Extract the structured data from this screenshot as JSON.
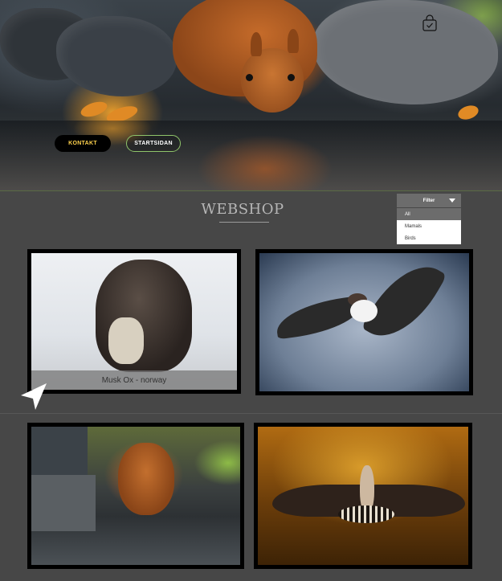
{
  "header": {
    "buttons": {
      "kontakt": "KONTAKT",
      "startsidan": "STARTSIDAN"
    },
    "icons": {
      "bag": "shopping-bag-check-icon"
    }
  },
  "webshop": {
    "title": "WEBSHOP",
    "filter": {
      "label": "Filter",
      "options": [
        "All",
        "Mamals",
        "Birds"
      ],
      "selected": "All"
    },
    "products": [
      {
        "caption": "Musk Ox - norway"
      },
      {
        "caption": ""
      },
      {
        "caption": ""
      },
      {
        "caption": ""
      }
    ]
  },
  "colors": {
    "kontakt_text": "#ffd24d",
    "startsidan_border": "#8fc46a",
    "background": "#474747"
  },
  "cursor": {
    "icon": "navigation-arrow-icon"
  }
}
